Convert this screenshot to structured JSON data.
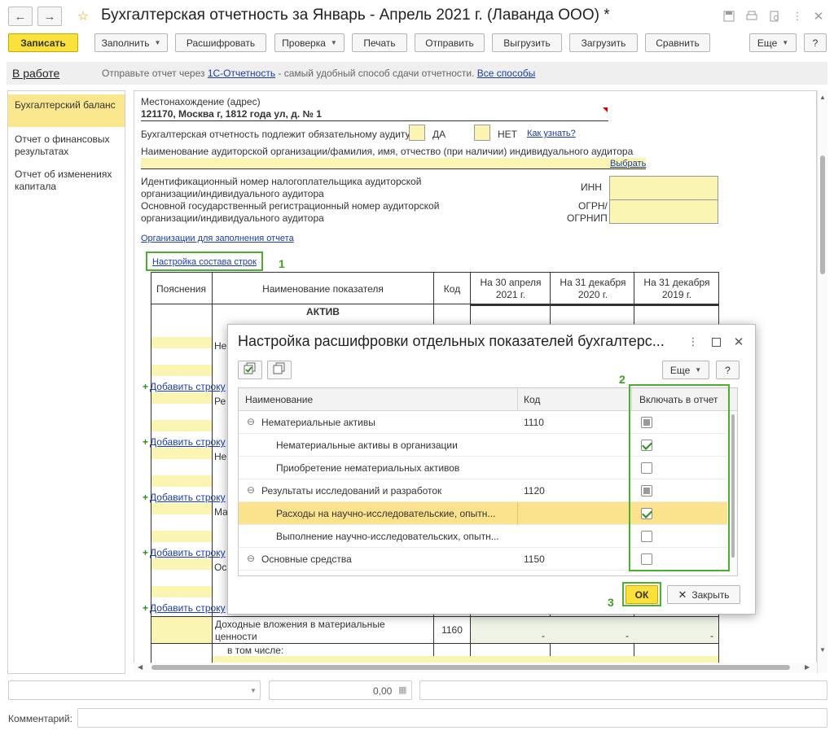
{
  "window": {
    "title": "Бухгалтерская отчетность за Январь - Апрель 2021 г. (Лаванда ООО) *",
    "back_icon": "←",
    "forward_icon": "→"
  },
  "toolbar": {
    "save": "Записать",
    "fill": "Заполнить",
    "decode": "Расшифровать",
    "check": "Проверка",
    "print": "Печать",
    "send": "Отправить",
    "export": "Выгрузить",
    "import": "Загрузить",
    "compare": "Сравнить",
    "more": "Еще",
    "help": "?"
  },
  "infobar": {
    "status": "В работе",
    "text_before": "Отправьте отчет через ",
    "link_1c": "1С-Отчетность",
    "text_after": " - самый удобный способ сдачи отчетности.",
    "link_all": "Все способы"
  },
  "sidebar": {
    "items": [
      {
        "label": "Бухгалтерский баланс"
      },
      {
        "label": "Отчет о финансовых результатах"
      },
      {
        "label": "Отчет об изменениях капитала"
      }
    ]
  },
  "form": {
    "address_label": "Местонахождение (адрес)",
    "address_value": "121170, Москва г, 1812 года ул, д. № 1",
    "audit_text": "Бухгалтерская отчетность подлежит обязательному аудиту",
    "audit_yes": "ДА",
    "audit_no": "НЕТ",
    "audit_link": "Как узнать?",
    "auditor_name_label": "Наименование аудиторской организации/фамилия, имя, отчество (при наличии) индивидуального аудитора",
    "choose_link": "Выбрать",
    "inn_text": "Идентификационный номер налогоплательщика аудиторской организации/индивидуального аудитора",
    "inn_label": "ИНН",
    "ogrn_text": "Основной государственный регистрационный номер аудиторской организации/индивидуального аудитора",
    "ogrn_label_1": "ОГРН/",
    "ogrn_label_2": "ОГРНИП",
    "orgs_link": "Организации для заполнения отчета",
    "rows_config_link": "Настройка состава строк",
    "table": {
      "col_notes": "Пояснения",
      "col_name": "Наименование показателя",
      "col_code": "Код",
      "col_d1": "На 30 апреля 2021 г.",
      "col_d2": "На 31 декабря 2020 г.",
      "col_d3": "На 31 декабря 2019 г.",
      "section": "АКТИВ",
      "add_row": "Добавить строку",
      "frag_1": "Не",
      "frag_2": "Ре",
      "frag_3": "Не",
      "frag_4": "Ма",
      "frag_5": "Ос",
      "income_name": "Доходные вложения в материальные ценности",
      "income_code": "1160",
      "income_dash": "-",
      "including": "в том числе:"
    }
  },
  "annotations": {
    "n1": "1",
    "n2": "2",
    "n3": "3"
  },
  "dialog": {
    "title": "Настройка расшифровки отдельных показателей бухгалтерс...",
    "more": "Еще",
    "help": "?",
    "col_name": "Наименование",
    "col_code": "Код",
    "col_include": "Включать в отчет",
    "rows": [
      {
        "name": "Нематериальные активы",
        "code": "1110",
        "level": 0,
        "state": "indeterminate"
      },
      {
        "name": "Нематериальные активы в организации",
        "code": "",
        "level": 1,
        "state": "checked"
      },
      {
        "name": "Приобретение нематериальных активов",
        "code": "",
        "level": 1,
        "state": "unchecked"
      },
      {
        "name": "Результаты исследований и разработок",
        "code": "1120",
        "level": 0,
        "state": "indeterminate"
      },
      {
        "name": "Расходы на научно-исследовательские, опытн...",
        "code": "",
        "level": 1,
        "state": "checked"
      },
      {
        "name": "Выполнение научно-исследовательских, опытн...",
        "code": "",
        "level": 1,
        "state": "unchecked"
      },
      {
        "name": "Основные средства",
        "code": "1150",
        "level": 0,
        "state": "unchecked"
      }
    ],
    "ok": "ОК",
    "close": "Закрыть"
  },
  "bottom": {
    "amount": "0,00",
    "comment_label": "Комментарий:"
  },
  "colors": {
    "accent_yellow": "#fbe13b",
    "highlight": "#fbe28c",
    "annotation_green": "#4caf2e",
    "link": "#1a3ca8"
  }
}
